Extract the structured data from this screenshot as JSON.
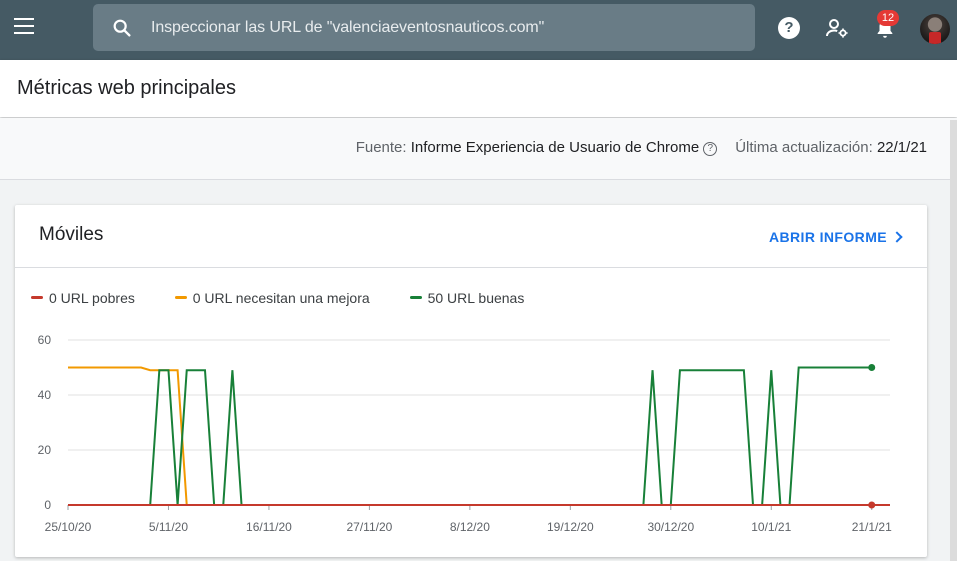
{
  "header": {
    "search_placeholder": "Inspeccionar las URL de \"valenciaeventosnauticos.com\"",
    "help_label": "?",
    "notification_count": "12"
  },
  "page": {
    "title": "Métricas web principales"
  },
  "source": {
    "prefix": "Fuente:",
    "name": "Informe Experiencia de Usuario de Chrome",
    "updated_label": "Última actualización:",
    "updated_value": "22/1/21"
  },
  "card": {
    "title": "Móviles",
    "open_report": "ABRIR INFORME"
  },
  "legend": [
    {
      "label": "0 URL pobres",
      "color": "#c5392c"
    },
    {
      "label": "0 URL necesitan una mejora",
      "color": "#f29900"
    },
    {
      "label": "50 URL buenas",
      "color": "#188038"
    }
  ],
  "chart_data": {
    "type": "line",
    "x_labels": [
      "25/10/20",
      "5/11/20",
      "16/11/20",
      "27/11/20",
      "8/12/20",
      "19/12/20",
      "30/12/20",
      "10/1/21",
      "21/1/21"
    ],
    "ylim": [
      0,
      60
    ],
    "yticks": [
      0,
      20,
      40,
      60
    ],
    "grid": true,
    "series": [
      {
        "name": "0 URL pobres",
        "color": "#c5392c",
        "points": [
          [
            0,
            0
          ],
          [
            90,
            0
          ]
        ]
      },
      {
        "name": "0 URL necesitan una mejora",
        "color": "#f29900",
        "points": [
          [
            0,
            50
          ],
          [
            8,
            50
          ],
          [
            9,
            49
          ],
          [
            12,
            49
          ],
          [
            13,
            0
          ]
        ]
      },
      {
        "name": "50 URL buenas",
        "color": "#188038",
        "points": [
          [
            9,
            0
          ],
          [
            10,
            49
          ],
          [
            11,
            49
          ],
          [
            12,
            0
          ],
          [
            13,
            49
          ],
          [
            15,
            49
          ],
          [
            16,
            0
          ],
          [
            17,
            0
          ],
          [
            18,
            49
          ],
          [
            19,
            0
          ],
          [
            63,
            0
          ],
          [
            64,
            49
          ],
          [
            65,
            0
          ],
          [
            66,
            0
          ],
          [
            67,
            49
          ],
          [
            74,
            49
          ],
          [
            75,
            0
          ],
          [
            76,
            0
          ],
          [
            77,
            49
          ],
          [
            78,
            0
          ],
          [
            79,
            0
          ],
          [
            80,
            50
          ],
          [
            88,
            50
          ],
          [
            88,
            50
          ]
        ]
      }
    ]
  }
}
